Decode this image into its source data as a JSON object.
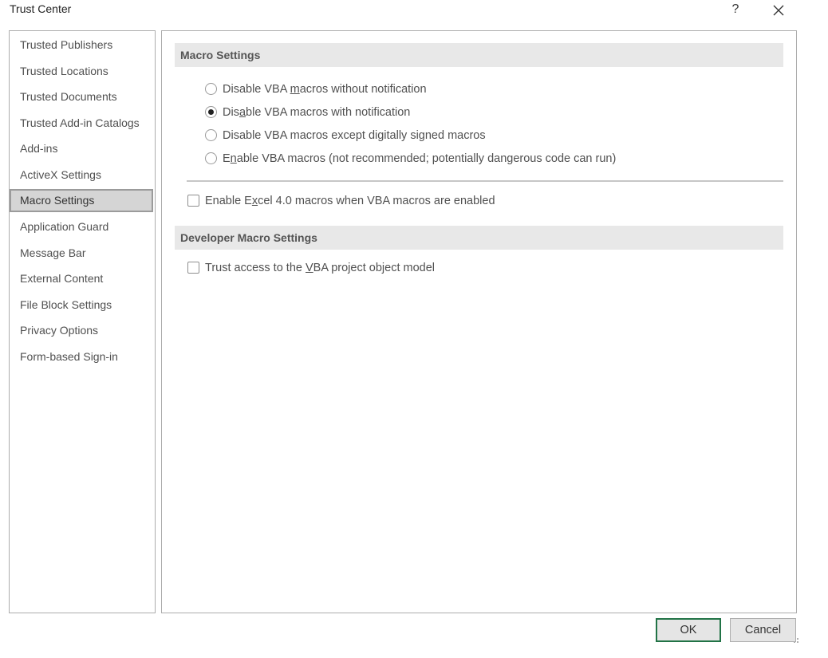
{
  "window": {
    "title": "Trust Center",
    "help_label": "?",
    "close_icon": "close-icon"
  },
  "sidebar": {
    "selected_index": 6,
    "items": [
      {
        "label": "Trusted Publishers"
      },
      {
        "label": "Trusted Locations"
      },
      {
        "label": "Trusted Documents"
      },
      {
        "label": "Trusted Add-in Catalogs"
      },
      {
        "label": "Add-ins"
      },
      {
        "label": "ActiveX Settings"
      },
      {
        "label": "Macro Settings"
      },
      {
        "label": "Application Guard"
      },
      {
        "label": "Message Bar"
      },
      {
        "label": "External Content"
      },
      {
        "label": "File Block Settings"
      },
      {
        "label": "Privacy Options"
      },
      {
        "label": "Form-based Sign-in"
      }
    ]
  },
  "main": {
    "macro_settings": {
      "header": "Macro Settings",
      "options": [
        {
          "pre": "Disable VBA ",
          "accel": "m",
          "post": "acros without notification",
          "checked": false
        },
        {
          "pre": "Dis",
          "accel": "a",
          "post": "ble VBA macros with notification",
          "checked": true
        },
        {
          "pre": "Disable VBA macros except digitally signed macros",
          "accel": "",
          "post": "",
          "checked": false
        },
        {
          "pre": "E",
          "accel": "n",
          "post": "able VBA macros (not recommended; potentially dangerous code can run)",
          "checked": false
        }
      ],
      "excel4": {
        "pre": "Enable E",
        "accel": "x",
        "post": "cel 4.0 macros when VBA macros are enabled",
        "checked": false
      }
    },
    "developer_settings": {
      "header": "Developer Macro Settings",
      "trust_vba": {
        "pre": "Trust access to the ",
        "accel": "V",
        "post": "BA project object model",
        "checked": false
      }
    }
  },
  "footer": {
    "ok_label": "OK",
    "cancel_label": "Cancel",
    "accent_color": "#217346"
  }
}
